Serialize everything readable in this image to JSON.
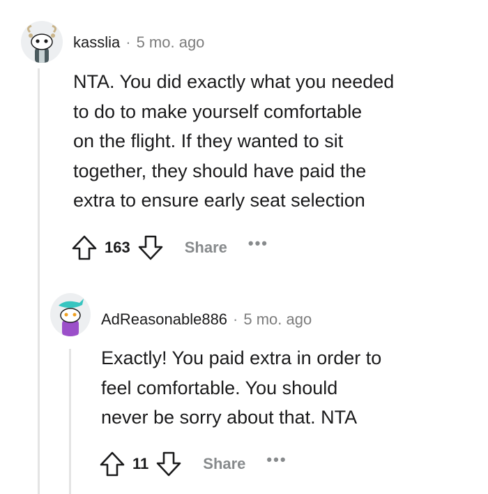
{
  "comments": [
    {
      "author": "kasslia",
      "separator": "·",
      "time": "5 mo. ago",
      "lines": [
        "NTA. You did exactly what you needed",
        "to do to make yourself comfortable",
        "on the flight. If they wanted to sit",
        "together, they should have paid the",
        "extra to ensure early seat selection"
      ],
      "score": "163",
      "share_label": "Share",
      "more_label": "•••"
    },
    {
      "author": "AdReasonable886",
      "separator": "·",
      "time": "5 mo. ago",
      "lines": [
        "Exactly! You paid extra in order to",
        "feel comfortable. You should",
        "never be sorry about that. NTA"
      ],
      "score": "11",
      "share_label": "Share",
      "more_label": "•••"
    }
  ]
}
